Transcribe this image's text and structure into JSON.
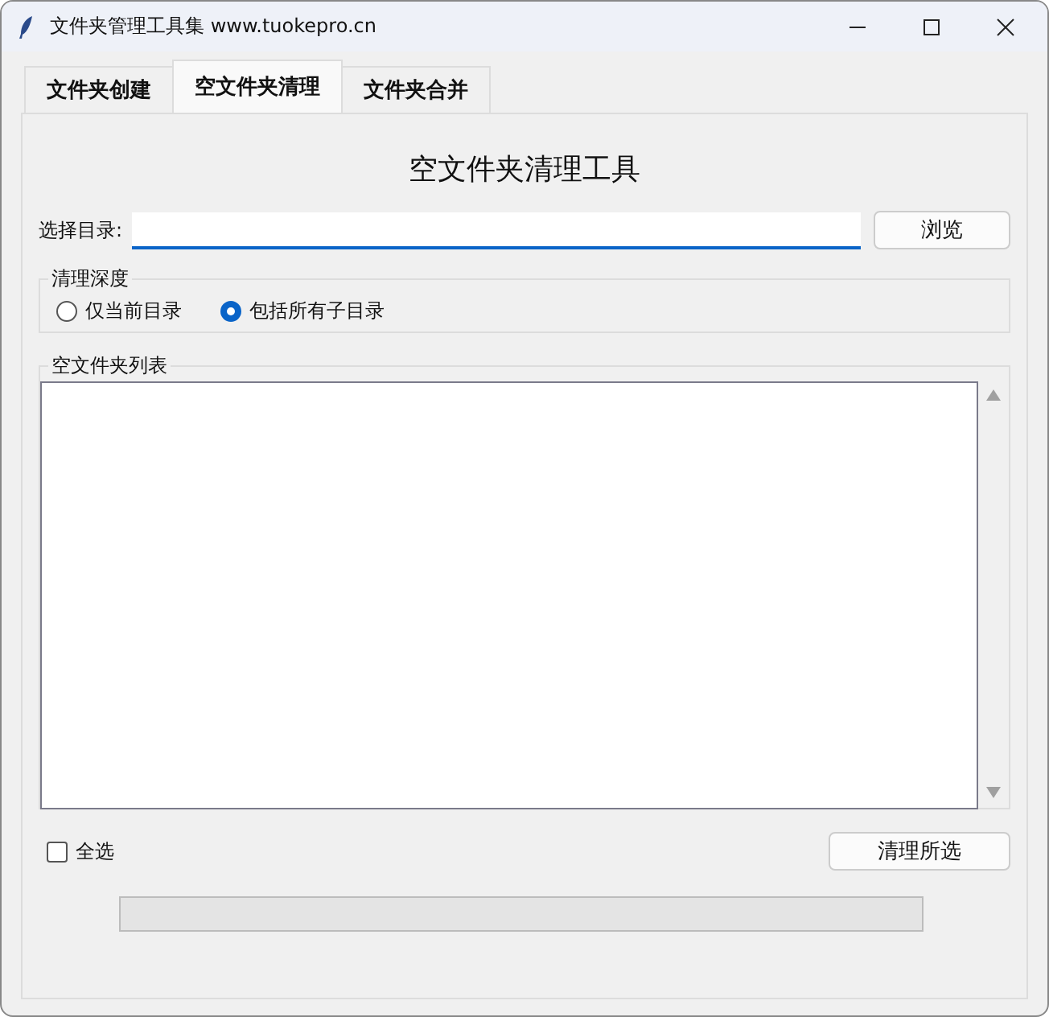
{
  "window": {
    "title": "文件夹管理工具集 www.tuokepro.cn"
  },
  "tabs": [
    {
      "label": "文件夹创建",
      "selected": false
    },
    {
      "label": "空文件夹清理",
      "selected": true
    },
    {
      "label": "文件夹合并",
      "selected": false
    }
  ],
  "heading": "空文件夹清理工具",
  "directory": {
    "label": "选择目录:",
    "browse_button": "浏览"
  },
  "depth": {
    "title": "清理深度",
    "options": [
      {
        "label": "仅当前目录",
        "selected": false
      },
      {
        "label": "包括所有子目录",
        "selected": true
      }
    ]
  },
  "list": {
    "title": "空文件夹列表"
  },
  "select_all": {
    "label": "全选",
    "checked": false
  },
  "clean_button": "清理所选"
}
